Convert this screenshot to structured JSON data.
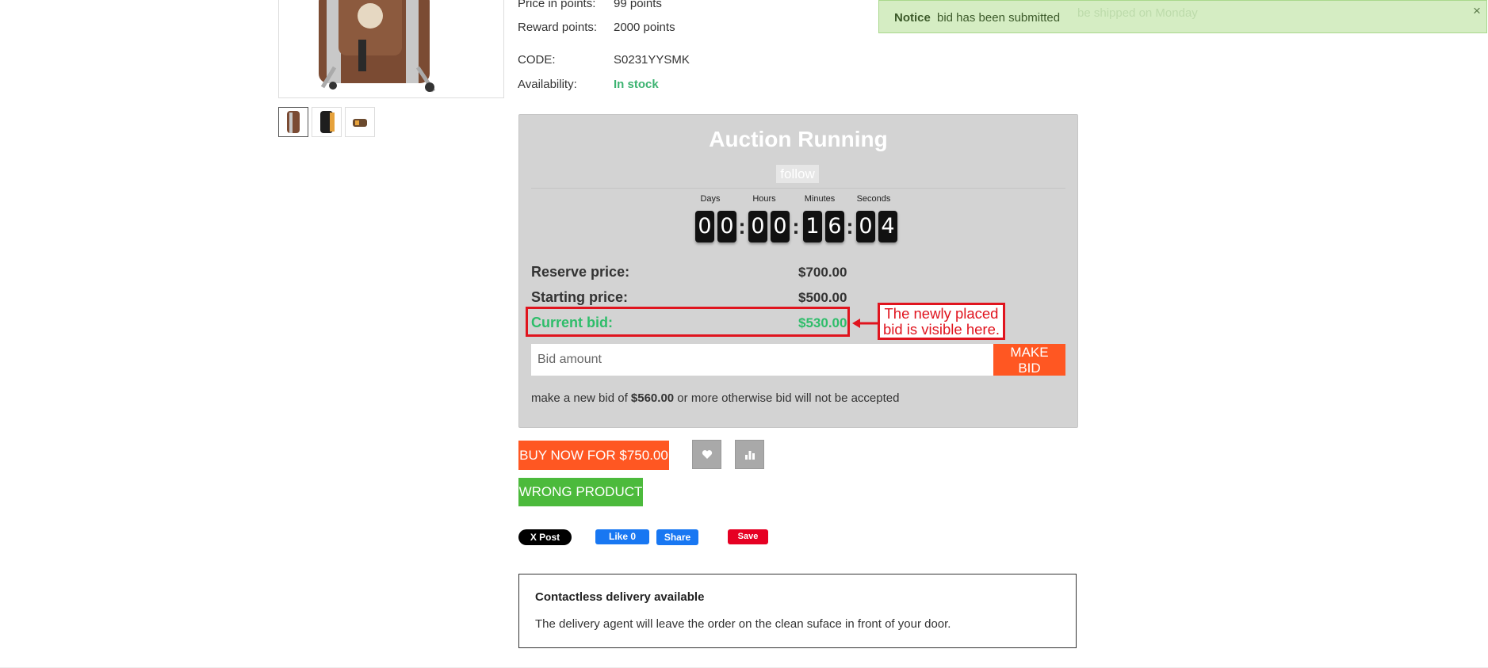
{
  "product_info": {
    "price_in_points_label": "Price in points:",
    "price_in_points_value": "99 points",
    "reward_points_label": "Reward points:",
    "reward_points_value": "2000 points",
    "code_label": "CODE:",
    "code_value": "S0231YYSMK",
    "availability_label": "Availability:",
    "availability_value": "In stock"
  },
  "auction": {
    "title": "Auction Running",
    "follow_label": "follow",
    "countdown": {
      "days_label": "Days",
      "hours_label": "Hours",
      "minutes_label": "Minutes",
      "seconds_label": "Seconds",
      "days": [
        "0",
        "0"
      ],
      "hours": [
        "0",
        "0"
      ],
      "minutes": [
        "1",
        "6"
      ],
      "seconds": [
        "0",
        "4"
      ]
    },
    "reserve_label": "Reserve price:",
    "reserve_value": "$700.00",
    "starting_label": "Starting price:",
    "starting_value": "$500.00",
    "current_label": "Current bid:",
    "current_value": "$530.00",
    "bid_placeholder": "Bid amount",
    "make_bid_label": "MAKE BID",
    "hint_before": "make a new bid of ",
    "hint_amount": "$560.00",
    "hint_after": " or more otherwise bid will not be accepted"
  },
  "annotation": {
    "line1": "The newly placed",
    "line2": "bid is visible here."
  },
  "actions": {
    "buy_now_label": "BUY NOW FOR $750.00",
    "wishlist_icon": "heart-icon",
    "compare_icon": "bar-chart-icon",
    "wrong_product_label": "WRONG PRODUCT"
  },
  "social": {
    "x_post_label": "X Post",
    "fb_like_label": "Like 0",
    "fb_share_label": "Share",
    "pinterest_save_label": "Save"
  },
  "delivery": {
    "title": "Contactless delivery available",
    "text": "The delivery agent will leave the order on the clean suface in front of your door."
  },
  "notice": {
    "title": "Notice",
    "message": "bid has been submitted",
    "ghost_text": "be shipped on Monday",
    "close_label": "×"
  },
  "colors": {
    "accent_orange": "#ff5722",
    "success_green": "#4cba3c",
    "current_bid_green": "#2ebd6a",
    "annotation_red": "#e0141e",
    "notice_bg": "#d5edc3"
  }
}
